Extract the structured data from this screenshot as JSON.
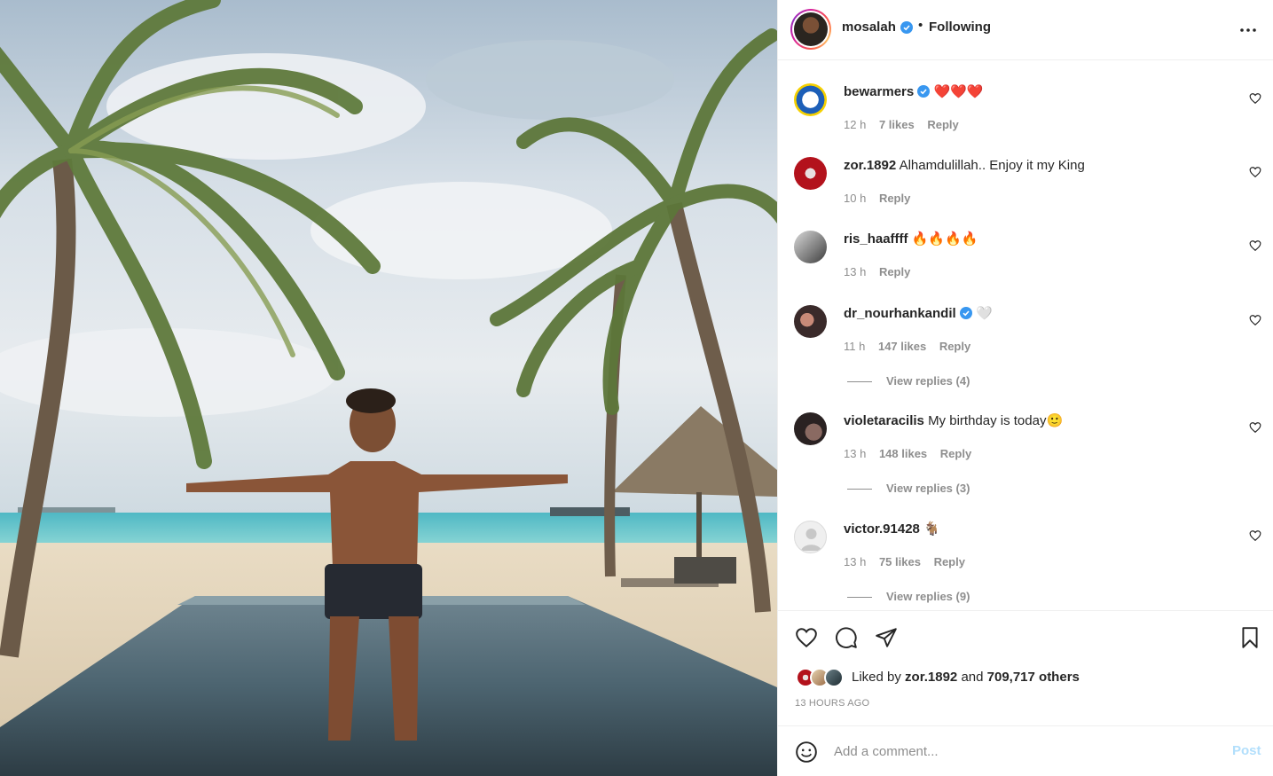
{
  "header": {
    "username": "mosalah",
    "separator": "•",
    "follow_state": "Following",
    "more_icon": "more-horizontal-icon"
  },
  "comments": [
    {
      "username": "bewarmers",
      "verified": true,
      "text": "❤️❤️❤️",
      "time": "12 h",
      "likes": "7 likes",
      "reply": "Reply",
      "view_replies": ""
    },
    {
      "username": "zor.1892",
      "verified": false,
      "text": "Alhamdulillah.. Enjoy it my King",
      "time": "10 h",
      "likes": "",
      "reply": "Reply",
      "view_replies": ""
    },
    {
      "username": "ris_haaffff",
      "verified": false,
      "text": "🔥🔥🔥🔥",
      "time": "13 h",
      "likes": "",
      "reply": "Reply",
      "view_replies": ""
    },
    {
      "username": "dr_nourhankandil",
      "verified": true,
      "text": "🤍",
      "time": "11 h",
      "likes": "147 likes",
      "reply": "Reply",
      "view_replies": "View replies (4)"
    },
    {
      "username": "violetaracilis",
      "verified": false,
      "text": "My birthday is today🙂",
      "time": "13 h",
      "likes": "148 likes",
      "reply": "Reply",
      "view_replies": "View replies (3)"
    },
    {
      "username": "victor.91428",
      "verified": false,
      "text": "🐐",
      "time": "13 h",
      "likes": "75 likes",
      "reply": "Reply",
      "view_replies": "View replies (9)"
    }
  ],
  "actions": {
    "like_icon": "heart-icon",
    "comment_icon": "comment-icon",
    "share_icon": "paper-plane-icon",
    "save_icon": "bookmark-icon"
  },
  "liked_by": {
    "prefix": "Liked by",
    "user": "zor.1892",
    "conjunction": "and",
    "others": "709,717 others"
  },
  "timestamp": "13 HOURS AGO",
  "comment_box": {
    "placeholder": "Add a comment...",
    "post_label": "Post",
    "emoji_icon": "smiley-icon"
  },
  "colors": {
    "verified_blue": "#3897f0",
    "muted_text": "#8e8e8e",
    "post_button_disabled": "#b2dffc"
  }
}
